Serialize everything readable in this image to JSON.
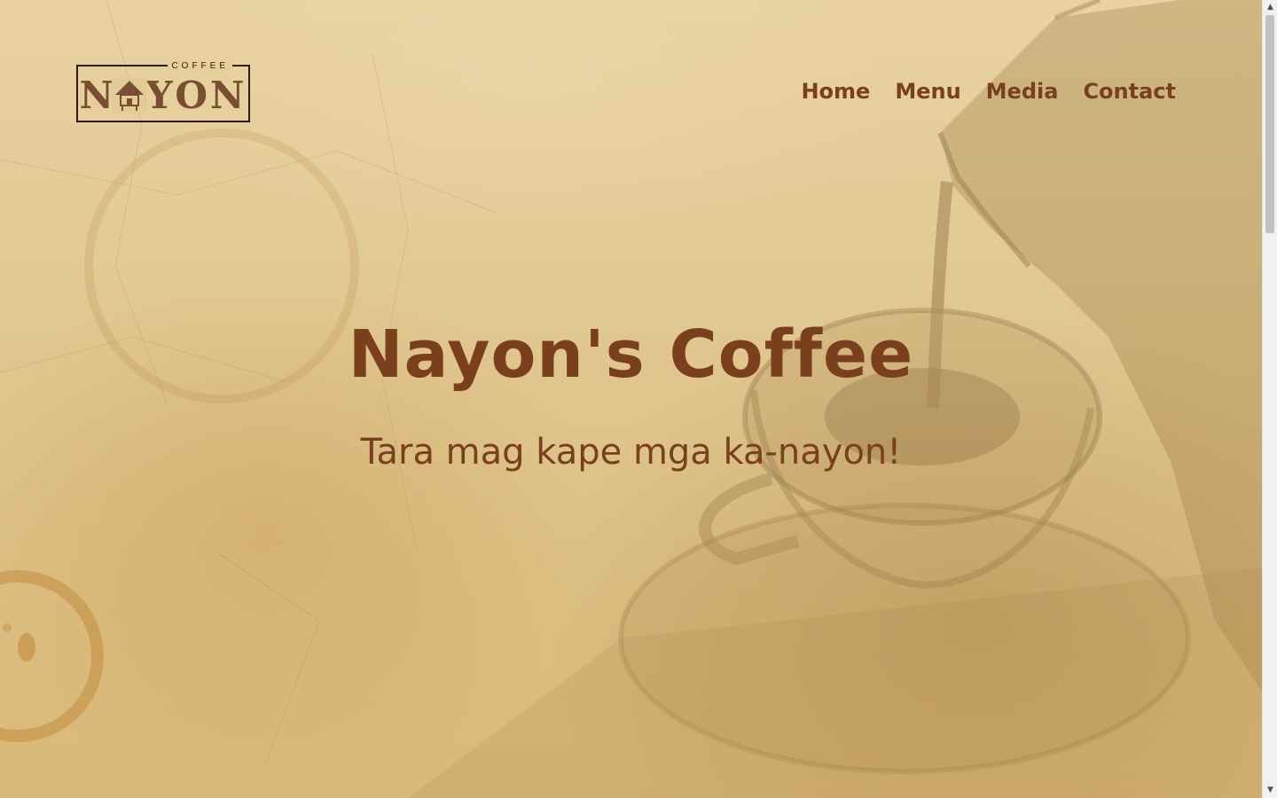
{
  "brand": {
    "logo_word": "NAYON",
    "logo_small": "COFFEE"
  },
  "nav": {
    "items": [
      {
        "label": "Home"
      },
      {
        "label": "Menu"
      },
      {
        "label": "Media"
      },
      {
        "label": "Contact"
      }
    ]
  },
  "hero": {
    "title": "Nayon's Coffee",
    "subtitle": "Tara mag kape mga ka-nayon!"
  },
  "colors": {
    "accent": "#7a3f1c",
    "background": "#e0c68e",
    "logo_border": "#2b1c10"
  },
  "scrollbar": {
    "up_icon": "▲",
    "down_icon": "▼"
  }
}
